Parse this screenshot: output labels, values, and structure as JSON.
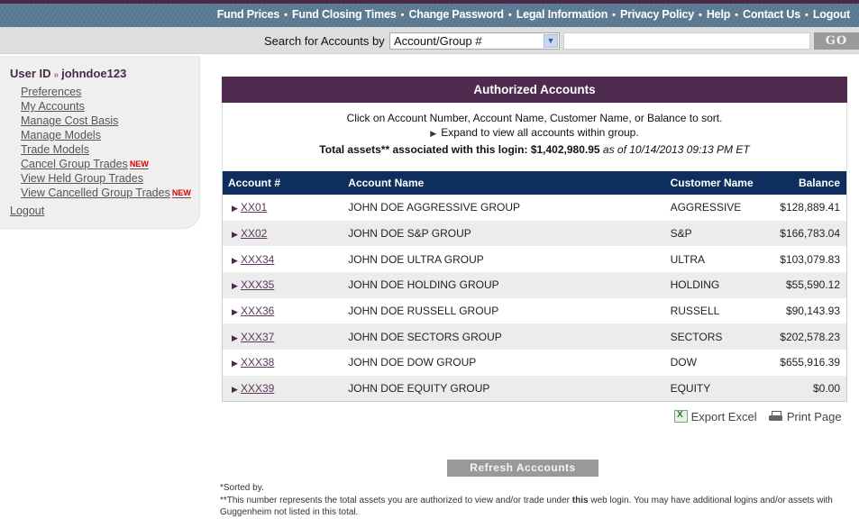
{
  "top_nav": {
    "links": [
      "Fund Prices",
      "Fund Closing Times",
      "Change Password",
      "Legal Information",
      "Privacy Policy",
      "Help",
      "Contact Us",
      "Logout"
    ],
    "separator": "•"
  },
  "search": {
    "label": "Search for Accounts by",
    "select_value": "Account/Group #",
    "input_value": "",
    "go_label": "GO"
  },
  "sidebar": {
    "user_label": "User ID",
    "user_chevron": "»",
    "username": "johndoe123",
    "items": [
      {
        "label": "Preferences",
        "badge": ""
      },
      {
        "label": "My Accounts",
        "badge": ""
      },
      {
        "label": "Manage Cost Basis",
        "badge": ""
      },
      {
        "label": "Manage Models",
        "badge": ""
      },
      {
        "label": "Trade Models",
        "badge": ""
      },
      {
        "label": "Cancel Group Trades",
        "badge": "NEW"
      },
      {
        "label": "View Held Group Trades",
        "badge": ""
      },
      {
        "label": "View Cancelled Group Trades",
        "badge": "NEW"
      }
    ],
    "logout": "Logout"
  },
  "panel": {
    "title": "Authorized Accounts",
    "sort_hint": "Click on Account Number, Account Name, Customer Name, or Balance to sort.",
    "expand_hint": "Expand to view all accounts within group.",
    "total_label": "Total assets** associated with this login:",
    "total_value": "$1,402,980.95",
    "as_of": "as of 10/14/2013 09:13 PM ET"
  },
  "table": {
    "headers": [
      "Account #",
      "Account Name",
      "Customer Name",
      "Balance"
    ],
    "rows": [
      {
        "account": "XX01",
        "name": "JOHN DOE AGGRESSIVE GROUP",
        "customer": "AGGRESSIVE",
        "balance": "$128,889.41"
      },
      {
        "account": "XX02",
        "name": "JOHN DOE S&P GROUP",
        "customer": "S&P",
        "balance": "$166,783.04"
      },
      {
        "account": "XXX34",
        "name": "JOHN DOE ULTRA GROUP",
        "customer": "ULTRA",
        "balance": "$103,079.83"
      },
      {
        "account": "XXX35",
        "name": "JOHN DOE HOLDING GROUP",
        "customer": "HOLDING",
        "balance": "$55,590.12"
      },
      {
        "account": "XXX36",
        "name": "JOHN DOE RUSSELL GROUP",
        "customer": "RUSSELL",
        "balance": "$90,143.93"
      },
      {
        "account": "XXX37",
        "name": "JOHN DOE SECTORS GROUP",
        "customer": "SECTORS",
        "balance": "$202,578.23"
      },
      {
        "account": "XXX38",
        "name": "JOHN DOE DOW GROUP",
        "customer": "DOW",
        "balance": "$655,916.39"
      },
      {
        "account": "XXX39",
        "name": "JOHN DOE EQUITY GROUP",
        "customer": "EQUITY",
        "balance": "$0.00"
      }
    ]
  },
  "actions": {
    "export_excel": "Export Excel",
    "print_page": "Print Page"
  },
  "refresh_label": "Refresh Acccounts",
  "footnotes": {
    "sorted_by": "*Sorted by.",
    "note_before": "**This number represents the total assets you are authorized to view and/or trade under",
    "note_bold": "this",
    "note_after": "web login. You may have additional logins and/or assets with Guggenheim not listed in this total."
  },
  "colors": {
    "brand_purple": "#4f2a4f",
    "nav_slate": "#5b7a93",
    "table_header_navy": "#0e2f5e",
    "new_badge_red": "#dd0000"
  }
}
